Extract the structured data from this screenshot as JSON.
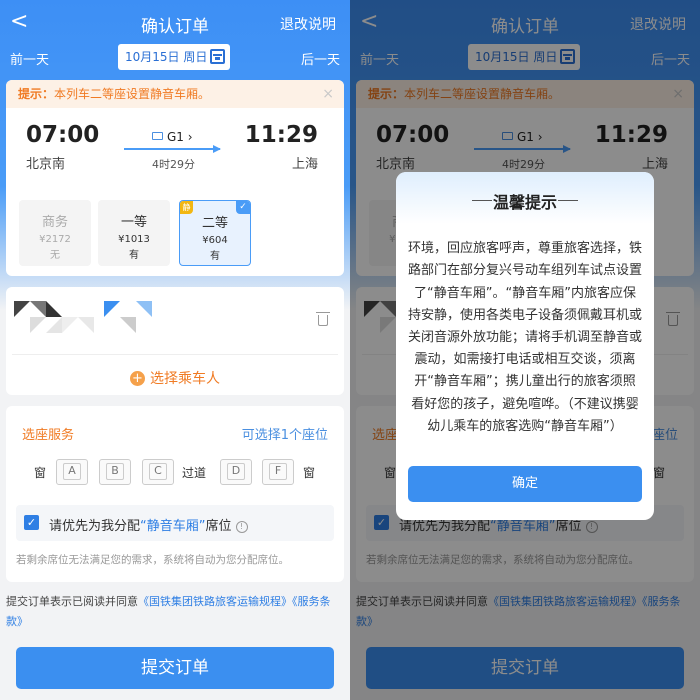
{
  "nav": {
    "title": "确认订单",
    "right_link": "退改说明"
  },
  "day_bar": {
    "prev": "前一天",
    "next": "后一天",
    "date": "10月15日 周日"
  },
  "tip": {
    "label": "提示：",
    "text": "本列车二等座设置静音车厢。"
  },
  "train": {
    "dep_time": "07:00",
    "dep_station": "北京南",
    "arr_time": "11:29",
    "arr_station": "上海",
    "number": "G1",
    "duration": "4时29分"
  },
  "seat_classes": [
    {
      "name": "商务",
      "price": "¥2172",
      "avail": "无"
    },
    {
      "name": "一等",
      "price": "¥1013",
      "avail": "有"
    },
    {
      "name": "二等",
      "price": "¥604",
      "avail": "有",
      "tag": "静"
    }
  ],
  "passenger": {
    "add_label": "选择乘车人"
  },
  "seat_service": {
    "title": "选座服务",
    "avail": "可选择1个座位",
    "window": "窗",
    "aisle": "过道",
    "seats": [
      "A",
      "B",
      "C",
      "D",
      "F"
    ]
  },
  "preference": {
    "pre": "请优先为我分配",
    "highlight": "“静音车厢”",
    "post": "席位"
  },
  "auto_note": "若剩余席位无法满足您的需求，系统将自动为您分配席位。",
  "agreement": {
    "pre": "提交订单表示已阅读并同意",
    "link1": "《国铁集团铁路旅客运输规程》",
    "link2": "《服务条款》"
  },
  "submit": "提交订单",
  "modal": {
    "title": "温馨提示",
    "body": "为共建共享文明、温馨、安静的列车旅行环境，回应旅客呼声，尊重旅客选择，铁路部门在部分复兴号动车组列车试点设置了“静音车厢”。“静音车厢”内旅客应保持安静，使用各类电子设备须佩戴耳机或关闭音源外放功能；请将手机调至静音或震动，如需接打电话或相互交谈，须离开“静音车厢”；携儿童出行的旅客须照看好您的孩子，避免喧哗。（不建议携婴幼儿乘车的旅客选购“静音车厢”）",
    "confirm": "确定"
  },
  "colors": {
    "accent": "#3b8ff0",
    "orange": "#f07b24",
    "quiet_tag": "#f2b712"
  }
}
